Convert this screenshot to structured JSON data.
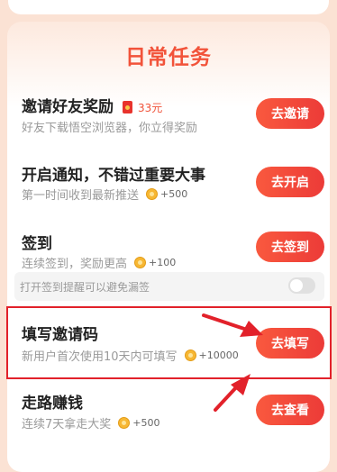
{
  "section_title": "日常任务",
  "tasks": [
    {
      "title": "邀请好友奖励",
      "reward": "33元",
      "desc": "好友下载悟空浏览器，你立得奖励",
      "button": "去邀请"
    },
    {
      "title": "开启通知，不错过重要大事",
      "desc": "第一时间收到最新推送",
      "coins": "+500",
      "button": "去开启"
    },
    {
      "title": "签到",
      "desc": "连续签到，奖励更高",
      "coins": "+100",
      "button": "去签到"
    },
    {
      "title": "填写邀请码",
      "desc": "新用户首次使用10天内可填写",
      "coins": "+10000",
      "button": "去填写"
    },
    {
      "title": "走路赚钱",
      "desc": "连续7天拿走大奖",
      "coins": "+500",
      "button": "去查看"
    }
  ],
  "reminder": {
    "label": "打开签到提醒可以避免漏签",
    "enabled": false
  },
  "colors": {
    "accent": "#f2533a",
    "button": "#ef4337",
    "highlight": "#e2212a",
    "background": "#fbe2d4"
  },
  "icons": {
    "reward": "red-packet-icon",
    "coin": "coin-icon"
  }
}
